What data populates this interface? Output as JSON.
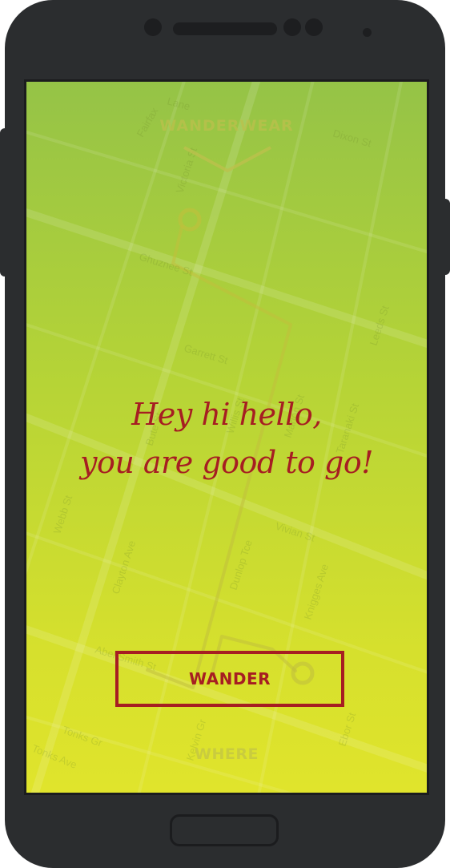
{
  "app": {
    "brand": "WANDERWEAR",
    "headline_line1": "Hey hi hello,",
    "headline_line2": "you are good to go!",
    "wander_button": "WANDER",
    "bottom_link": "WHERE"
  },
  "map": {
    "streets": [
      "Lane",
      "Fairfax",
      "Victoria St",
      "Dixon St",
      "Ghuznee St",
      "Leeds St",
      "Garrett St",
      "Bute St",
      "Marion St",
      "Taranaki St",
      "Willis St",
      "Vivian St",
      "Dunlop Tce",
      "Webb St",
      "Clayton Ave",
      "Knigges Ave",
      "Abel Smith St",
      "Tonks Gr",
      "Tonks Ave",
      "Kelvin Gr",
      "Ebor St"
    ]
  },
  "colors": {
    "accent": "#a61e22",
    "gradient_top": "#95c347",
    "gradient_bottom": "#e0e42c",
    "device_body": "#2b2d2f"
  }
}
